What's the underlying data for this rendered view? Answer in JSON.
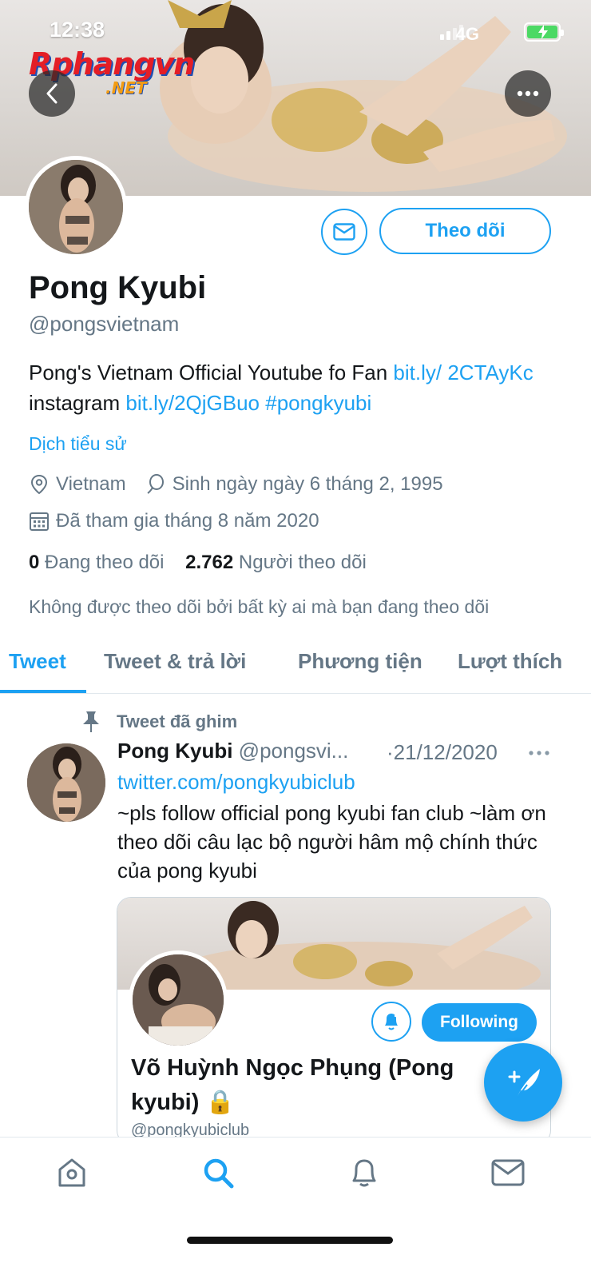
{
  "status_bar": {
    "time": "12:38",
    "network": "4G"
  },
  "watermark": {
    "line1": "Rphangvn",
    "line2": ".NET"
  },
  "profile": {
    "name": "Pong Kyubi",
    "handle": "@pongsvietnam",
    "follow_label": "Theo dõi",
    "bio_text_1": "Pong's Vietnam Official Youtube fo Fan ",
    "bio_link_1": "bit.ly/ 2CTAyKc",
    "bio_text_2": " instagram ",
    "bio_link_2": "bit.ly/2QjGBuo",
    "bio_hashtag": "#pongkyubi",
    "translate_label": "Dịch tiểu sử",
    "location": "Vietnam",
    "birthday": "Sinh ngày ngày 6 tháng 2, 1995",
    "joined": "Đã tham gia tháng 8 năm 2020",
    "following_count": "0",
    "following_label": "Đang theo dõi",
    "followers_count": "2.762",
    "followers_label": "Người theo dõi",
    "not_followed_note": "Không được theo dõi bởi bất kỳ ai mà bạn đang theo dõi"
  },
  "tabs": [
    "Tweet",
    "Tweet & trả lời",
    "Phương tiện",
    "Lượt thích"
  ],
  "pinned_tweet": {
    "pin_label": "Tweet đã ghim",
    "author": "Pong Kyubi",
    "handle": "@pongsvi...",
    "date": "·21/12/2020",
    "link": "twitter.com/pongkyubiclub",
    "text": "~pls follow official pong kyubi fan club ~làm ơn theo dõi câu lạc bộ người hâm mộ chính thức của pong kyubi",
    "card": {
      "name": "Võ Huỳnh Ngọc Phụng (Pong kyubi) 🔒",
      "handle": "@pongkyubiclub",
      "following_label": "Following"
    }
  },
  "colors": {
    "accent": "#1da1f2",
    "secondary_text": "#657786",
    "primary_text": "#14171a"
  },
  "icons": {
    "back": "chevron-left-icon",
    "more": "more-horizontal-icon",
    "message": "envelope-icon",
    "location": "location-pin-icon",
    "birthday": "balloon-icon",
    "calendar": "calendar-icon",
    "pin": "pin-icon",
    "compose": "compose-feather-icon",
    "nav": [
      "home-icon",
      "search-icon",
      "bell-icon",
      "mail-icon"
    ]
  }
}
